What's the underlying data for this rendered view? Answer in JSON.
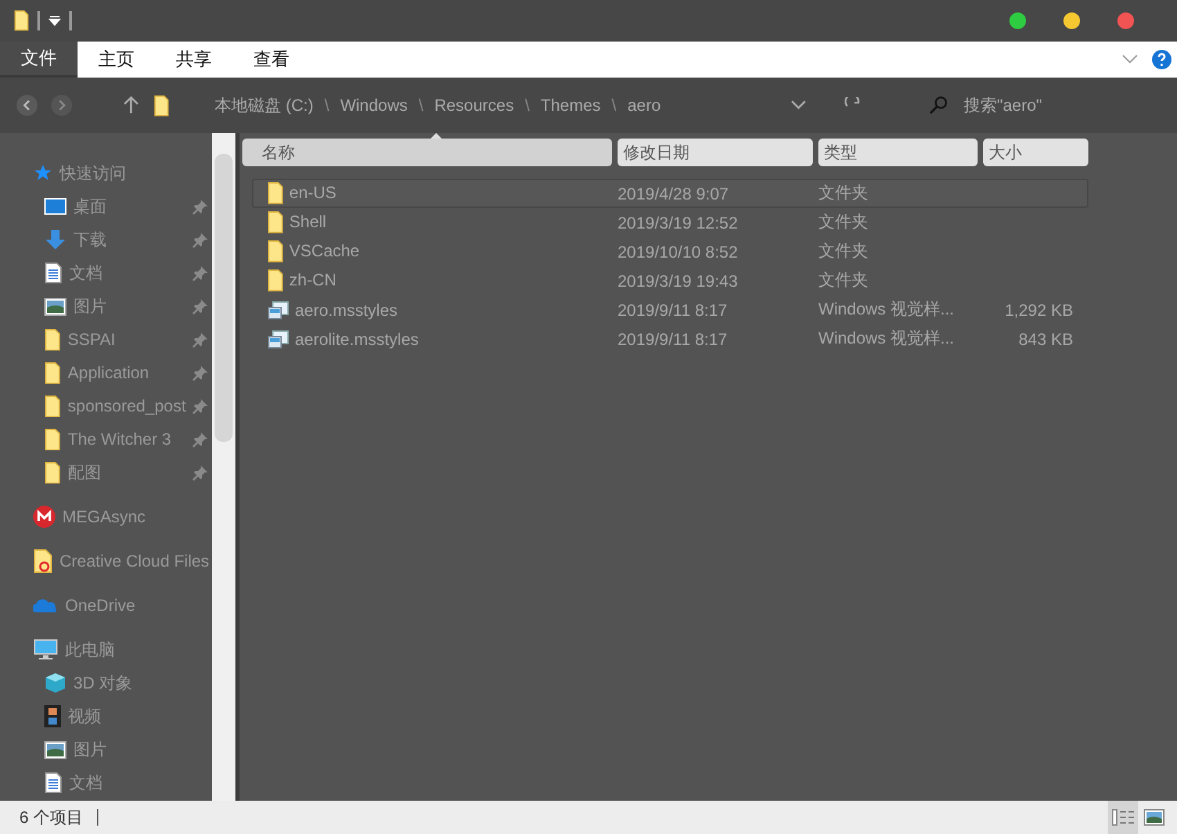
{
  "window": {
    "controls": [
      {
        "color": "#2ecc40"
      },
      {
        "color": "#f5c730"
      },
      {
        "color": "#f25454"
      }
    ]
  },
  "ribbon": {
    "tabs": [
      {
        "label": "文件",
        "selected": true
      },
      {
        "label": "主页",
        "selected": false
      },
      {
        "label": "共享",
        "selected": false
      },
      {
        "label": "查看",
        "selected": false
      }
    ]
  },
  "address_bar": {
    "path": [
      "本地磁盘 (C:)",
      "Windows",
      "Resources",
      "Themes",
      "aero"
    ],
    "separator": "\\",
    "search": {
      "placeholder": "搜索\"aero\""
    }
  },
  "sidebar": {
    "groups": [
      {
        "label": "快速访问",
        "kind": "star",
        "children": [
          {
            "label": "桌面",
            "kind": "desktop",
            "pinned": true
          },
          {
            "label": "下载",
            "kind": "download",
            "pinned": true
          },
          {
            "label": "文档",
            "kind": "document",
            "pinned": true
          },
          {
            "label": "图片",
            "kind": "pictures",
            "pinned": true
          },
          {
            "label": "SSPAI",
            "kind": "folder",
            "pinned": true
          },
          {
            "label": "Application",
            "kind": "folder",
            "pinned": true
          },
          {
            "label": "sponsored_post",
            "kind": "folder",
            "pinned": true
          },
          {
            "label": "The Witcher 3",
            "kind": "folder",
            "pinned": true
          },
          {
            "label": "配图",
            "kind": "folder",
            "pinned": true
          }
        ]
      },
      {
        "label": "MEGAsync",
        "kind": "mega"
      },
      {
        "label": "Creative Cloud Files",
        "kind": "cc"
      },
      {
        "label": "OneDrive",
        "kind": "onedrive"
      },
      {
        "label": "此电脑",
        "kind": "computer",
        "children": [
          {
            "label": "3D 对象",
            "kind": "cube"
          },
          {
            "label": "视频",
            "kind": "video"
          },
          {
            "label": "图片",
            "kind": "pictures"
          },
          {
            "label": "文档",
            "kind": "document"
          }
        ]
      }
    ]
  },
  "table": {
    "columns": [
      "名称",
      "修改日期",
      "类型",
      "大小"
    ],
    "rows": [
      {
        "name": "en-US",
        "date": "2019/4/28 9:07",
        "type": "文件夹",
        "kind": "folder",
        "selected": true
      },
      {
        "name": "Shell",
        "date": "2019/3/19 12:52",
        "type": "文件夹",
        "kind": "folder",
        "selected": false
      },
      {
        "name": "VSCache",
        "date": "2019/10/10 8:52",
        "type": "文件夹",
        "kind": "folder",
        "selected": false
      },
      {
        "name": "zh-CN",
        "date": "2019/3/19 19:43",
        "type": "文件夹",
        "kind": "folder",
        "selected": false
      },
      {
        "name": "aero.msstyles",
        "date": "2019/9/11 8:17",
        "type": "Windows 视觉样...",
        "size": "1,292 KB",
        "kind": "file",
        "selected": false
      },
      {
        "name": "aerolite.msstyles",
        "date": "2019/9/11 8:17",
        "type": "Windows 视觉样...",
        "size": "843 KB",
        "kind": "file",
        "selected": false
      }
    ]
  },
  "status_bar": {
    "count": "6 个项目",
    "views": [
      {
        "kind": "details",
        "selected": true
      },
      {
        "kind": "thumbnails",
        "selected": false
      }
    ]
  }
}
